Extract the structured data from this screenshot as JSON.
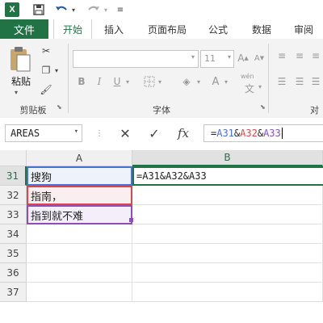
{
  "app": {
    "logo": "X"
  },
  "qat": {
    "icons": [
      "excel-logo",
      "save-icon",
      "undo-icon",
      "redo-icon",
      "customize-icon"
    ]
  },
  "tabs": {
    "file": "文件",
    "items": [
      "开始",
      "插入",
      "页面布局",
      "公式",
      "数据",
      "审阅"
    ],
    "active": "开始"
  },
  "ribbon": {
    "paste_label": "粘贴",
    "clipboard_label": "剪贴板",
    "font_size": "11",
    "font_group_label": "字体",
    "align_group_label_partial": "对",
    "wen_label": "wén"
  },
  "formula_bar": {
    "name_box": "AREAS",
    "formula": "=A31&A32&A33",
    "fx": "fx"
  },
  "grid": {
    "columns": [
      "A",
      "B"
    ],
    "rows": [
      "31",
      "32",
      "33",
      "34",
      "35",
      "36",
      "37"
    ],
    "cells": {
      "A31": "搜狗",
      "A32": "指南，",
      "A33": "指到就不难",
      "B31": "=A31&A32&A33"
    },
    "colors": {
      "a31_border": "#4a6fd6",
      "a32_border": "#d94848",
      "a33_border": "#8a4fb8",
      "accent": "#217346"
    }
  }
}
